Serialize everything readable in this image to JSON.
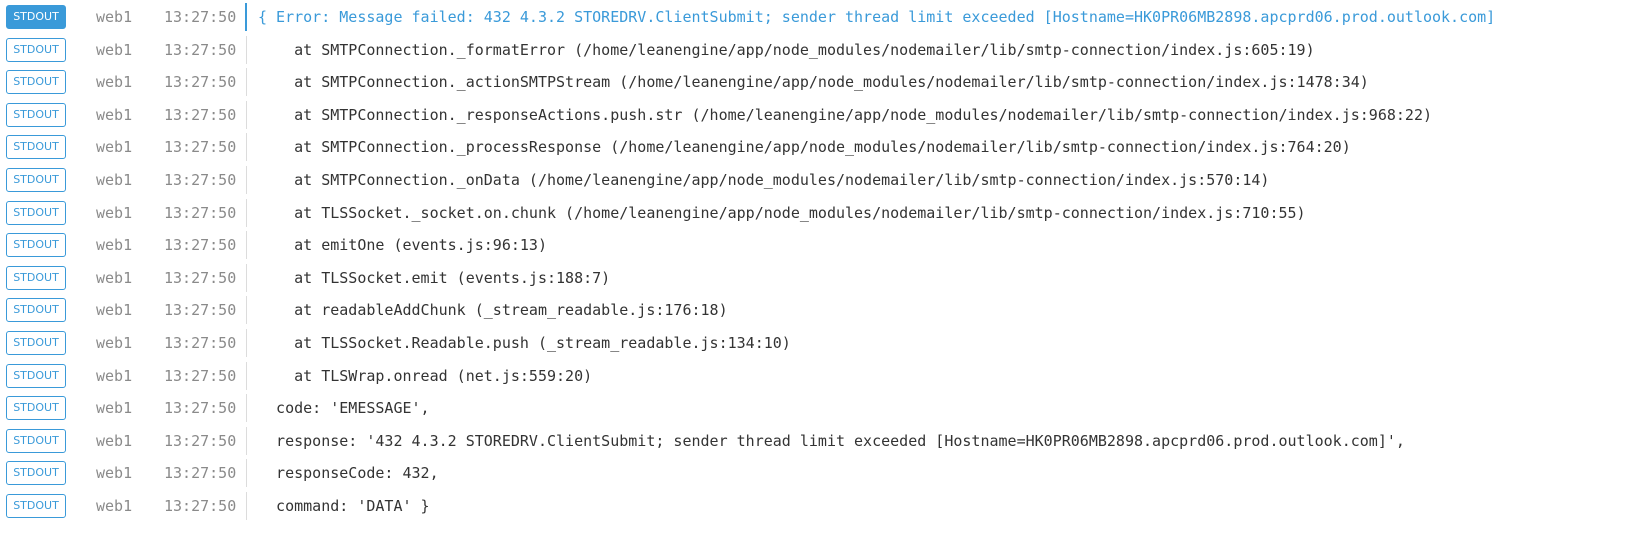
{
  "colors": {
    "accent": "#3a9ad9",
    "muted": "#8a8a8a",
    "text": "#333333"
  },
  "log": {
    "rows": [
      {
        "stream": "STDOUT",
        "host": "web1",
        "time": "13:27:50",
        "message": "{ Error: Message failed: 432 4.3.2 STOREDRV.ClientSubmit; sender thread limit exceeded [Hostname=HK0PR06MB2898.apcprd06.prod.outlook.com]"
      },
      {
        "stream": "STDOUT",
        "host": "web1",
        "time": "13:27:50",
        "message": "    at SMTPConnection._formatError (/home/leanengine/app/node_modules/nodemailer/lib/smtp-connection/index.js:605:19)"
      },
      {
        "stream": "STDOUT",
        "host": "web1",
        "time": "13:27:50",
        "message": "    at SMTPConnection._actionSMTPStream (/home/leanengine/app/node_modules/nodemailer/lib/smtp-connection/index.js:1478:34)"
      },
      {
        "stream": "STDOUT",
        "host": "web1",
        "time": "13:27:50",
        "message": "    at SMTPConnection._responseActions.push.str (/home/leanengine/app/node_modules/nodemailer/lib/smtp-connection/index.js:968:22)"
      },
      {
        "stream": "STDOUT",
        "host": "web1",
        "time": "13:27:50",
        "message": "    at SMTPConnection._processResponse (/home/leanengine/app/node_modules/nodemailer/lib/smtp-connection/index.js:764:20)"
      },
      {
        "stream": "STDOUT",
        "host": "web1",
        "time": "13:27:50",
        "message": "    at SMTPConnection._onData (/home/leanengine/app/node_modules/nodemailer/lib/smtp-connection/index.js:570:14)"
      },
      {
        "stream": "STDOUT",
        "host": "web1",
        "time": "13:27:50",
        "message": "    at TLSSocket._socket.on.chunk (/home/leanengine/app/node_modules/nodemailer/lib/smtp-connection/index.js:710:55)"
      },
      {
        "stream": "STDOUT",
        "host": "web1",
        "time": "13:27:50",
        "message": "    at emitOne (events.js:96:13)"
      },
      {
        "stream": "STDOUT",
        "host": "web1",
        "time": "13:27:50",
        "message": "    at TLSSocket.emit (events.js:188:7)"
      },
      {
        "stream": "STDOUT",
        "host": "web1",
        "time": "13:27:50",
        "message": "    at readableAddChunk (_stream_readable.js:176:18)"
      },
      {
        "stream": "STDOUT",
        "host": "web1",
        "time": "13:27:50",
        "message": "    at TLSSocket.Readable.push (_stream_readable.js:134:10)"
      },
      {
        "stream": "STDOUT",
        "host": "web1",
        "time": "13:27:50",
        "message": "    at TLSWrap.onread (net.js:559:20)"
      },
      {
        "stream": "STDOUT",
        "host": "web1",
        "time": "13:27:50",
        "message": "  code: 'EMESSAGE',"
      },
      {
        "stream": "STDOUT",
        "host": "web1",
        "time": "13:27:50",
        "message": "  response: '432 4.3.2 STOREDRV.ClientSubmit; sender thread limit exceeded [Hostname=HK0PR06MB2898.apcprd06.prod.outlook.com]',"
      },
      {
        "stream": "STDOUT",
        "host": "web1",
        "time": "13:27:50",
        "message": "  responseCode: 432,"
      },
      {
        "stream": "STDOUT",
        "host": "web1",
        "time": "13:27:50",
        "message": "  command: 'DATA' }"
      }
    ]
  }
}
